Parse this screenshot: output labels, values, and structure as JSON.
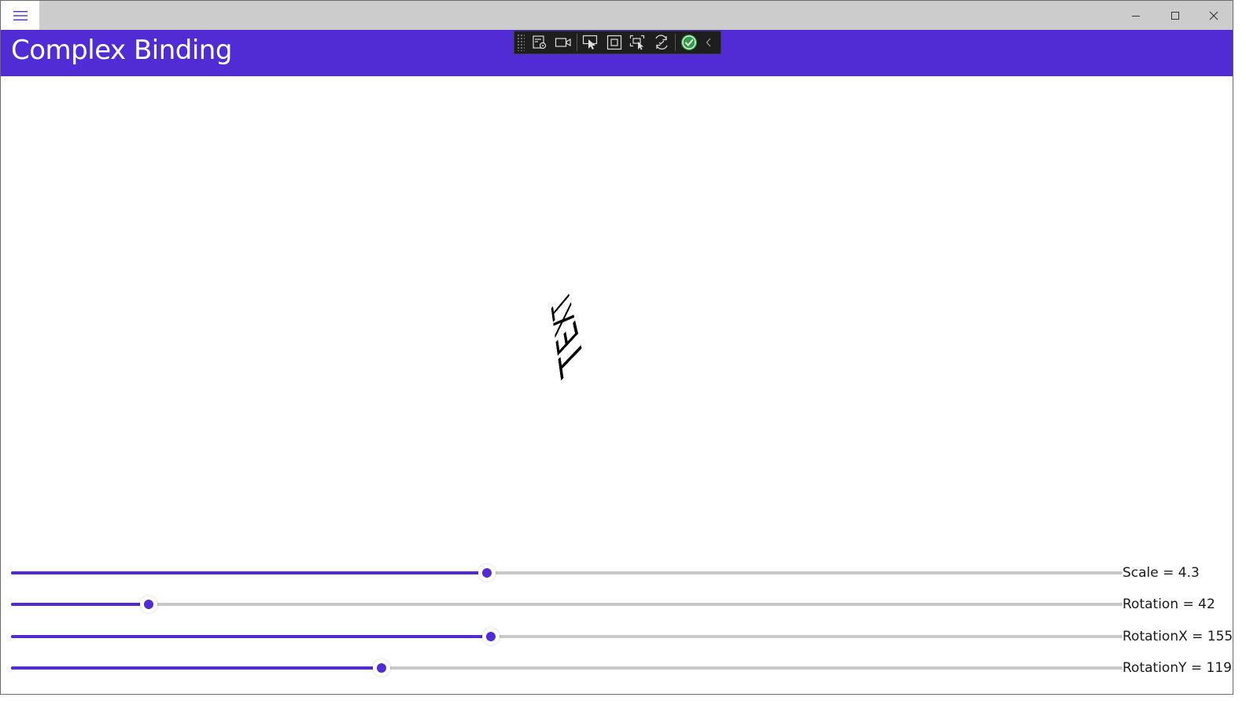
{
  "window": {
    "title_bar": {
      "menu_icon": "hamburger-menu-icon",
      "controls": [
        "minimize-icon",
        "maximize-icon",
        "close-icon"
      ]
    },
    "header": {
      "title": "Complex Binding",
      "background": "#512bd4"
    },
    "debug_toolbar": {
      "buttons": [
        "live-visual-tree-icon",
        "record-icon",
        "select-element-icon",
        "display-layout-adorners-icon",
        "track-focused-element-icon",
        "hot-reload-icon",
        "xaml-hot-reload-status-icon",
        "collapse-chevron-icon"
      ]
    }
  },
  "main": {
    "transformed_label": {
      "text": "TEXT"
    },
    "sliders": [
      {
        "label": "Scale = 4.3",
        "value_fraction": 0.428
      },
      {
        "label": "Rotation = 42",
        "value_fraction": 0.124
      },
      {
        "label": "RotationX = 155",
        "value_fraction": 0.432
      },
      {
        "label": "RotationY = 119",
        "value_fraction": 0.333
      }
    ]
  },
  "colors": {
    "accent": "#512bd4",
    "track": "#c8c8c8",
    "titlebar": "#cccccc"
  }
}
